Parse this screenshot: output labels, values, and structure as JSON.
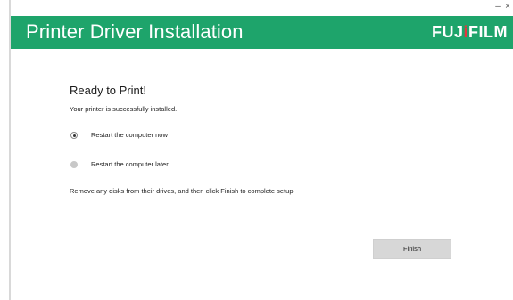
{
  "window": {
    "minimize_glyph": "–",
    "close_glyph": "×"
  },
  "header": {
    "title": "Printer Driver Installation",
    "logo_left": "FUJ",
    "logo_dot": "i",
    "logo_right": "FILM",
    "brand_color": "#1ea46b",
    "logo_dot_color": "#e7343f"
  },
  "content": {
    "heading": "Ready to Print!",
    "subtext": "Your printer is successfully installed.",
    "options": [
      {
        "label": "Restart the computer now",
        "selected": true
      },
      {
        "label": "Restart the computer later",
        "selected": false
      }
    ],
    "instructions": "Remove any disks from their drives, and then click Finish to complete setup."
  },
  "footer": {
    "finish_label": "Finish"
  }
}
